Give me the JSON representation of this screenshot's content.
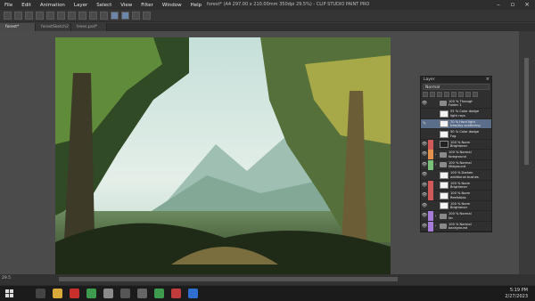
{
  "app": {
    "title": "forest* (A4 297.00 x 210.00mm 350dpi 29.5%) - CLIP STUDIO PAINT PRO",
    "menu": [
      "File",
      "Edit",
      "Animation",
      "Layer",
      "Select",
      "View",
      "Filter",
      "Window",
      "Help"
    ]
  },
  "tabs": [
    "forest*",
    "forestSketch2",
    "trees.psd*"
  ],
  "canvas": {
    "zoom_label": "29.5"
  },
  "layer_panel": {
    "title": "Layer",
    "blend_mode": "Normal",
    "layers": [
      {
        "eye": "👁",
        "color": "",
        "expand": "",
        "thumb": "folder",
        "line1": "100 % Through",
        "line2": "Folder 1",
        "selected": false
      },
      {
        "eye": "",
        "color": "",
        "expand": "",
        "thumb": "white",
        "line1": "55 % Color dodge",
        "line2": "light rays",
        "selected": false
      },
      {
        "eye": "✎",
        "color": "",
        "expand": "",
        "thumb": "white",
        "line1": "70 % Hard light",
        "line2": "tree/sky scattering",
        "selected": true
      },
      {
        "eye": "",
        "color": "",
        "expand": "",
        "thumb": "white",
        "line1": "50 % Color dodge",
        "line2": "Fog",
        "selected": false
      },
      {
        "eye": "👁",
        "color": "#d05a5a",
        "expand": "",
        "thumb": "dark",
        "line1": "100 % Norm",
        "line2": "Brightener",
        "selected": false
      },
      {
        "eye": "👁",
        "color": "#e4924e",
        "expand": "›",
        "thumb": "folder",
        "line1": "100 % Normal",
        "line2": "foreground",
        "selected": false
      },
      {
        "eye": "👁",
        "color": "#79c07a",
        "expand": "›",
        "thumb": "folder",
        "line1": "100 % Normal",
        "line2": "Midground",
        "selected": false
      },
      {
        "eye": "👁",
        "color": "",
        "expand": "",
        "thumb": "white",
        "line1": "100 % Darken",
        "line2": "additional bushes",
        "selected": false
      },
      {
        "eye": "👁",
        "color": "#d05a5a",
        "expand": "",
        "thumb": "white",
        "line1": "100 % Norm",
        "line2": "Brightener",
        "selected": false
      },
      {
        "eye": "👁",
        "color": "#d05a5a",
        "expand": "",
        "thumb": "white",
        "line1": "100 % Norm",
        "line2": "Reefxbias",
        "selected": false
      },
      {
        "eye": "👁",
        "color": "",
        "expand": "",
        "thumb": "white",
        "line1": "100 % Norm",
        "line2": "Brightener",
        "selected": false
      },
      {
        "eye": "👁",
        "color": "#a57cd8",
        "expand": "›",
        "thumb": "folder",
        "line1": "100 % Normal",
        "line2": "far",
        "selected": false
      },
      {
        "eye": "👁",
        "color": "#a57cd8",
        "expand": "›",
        "thumb": "folder",
        "line1": "100 % Normal",
        "line2": "background",
        "selected": false
      }
    ]
  },
  "taskbar": {
    "time": "5:19 PM",
    "date": "2/27/2023",
    "apps": [
      {
        "name": "task-view-icon",
        "color": "#444"
      },
      {
        "name": "file-explorer-icon",
        "color": "#d9a93a"
      },
      {
        "name": "acrobat-icon",
        "color": "#c9302c"
      },
      {
        "name": "chrome-icon",
        "color": "#3c9b4d"
      },
      {
        "name": "clip-studio-icon",
        "color": "#8a8a8a"
      },
      {
        "name": "camera-icon",
        "color": "#555"
      },
      {
        "name": "clock-icon",
        "color": "#666"
      },
      {
        "name": "chrome-icon-2",
        "color": "#3c9b4d"
      },
      {
        "name": "red-app-icon",
        "color": "#c03c3c"
      },
      {
        "name": "blue-app-icon",
        "color": "#2f6fd0"
      }
    ]
  }
}
